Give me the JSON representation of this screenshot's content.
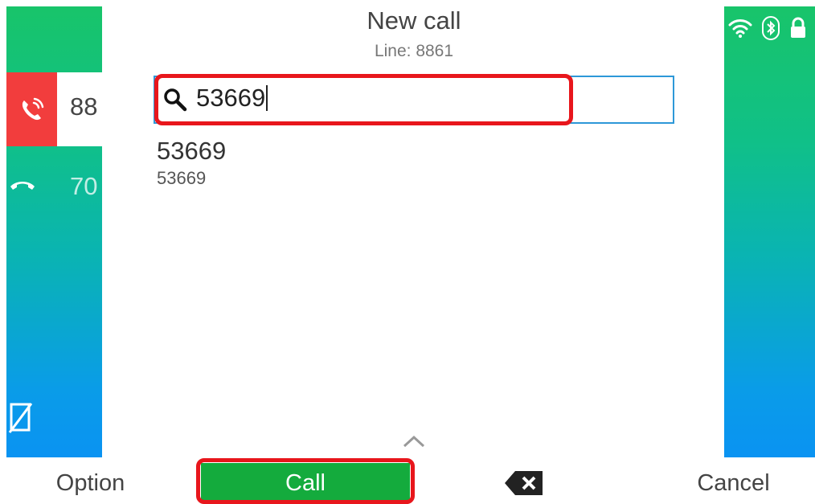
{
  "header": {
    "title": "New call",
    "subtitle": "Line: 8861"
  },
  "lines": [
    {
      "label": "88",
      "state": "active",
      "icon": "call-active-icon",
      "color": "#f23d3d"
    },
    {
      "label": "70",
      "state": "idle",
      "icon": "handset-icon"
    }
  ],
  "status_icons": [
    "wifi-icon",
    "bluetooth-icon",
    "lock-icon"
  ],
  "search": {
    "value": "53669"
  },
  "results": [
    {
      "name": "53669",
      "number": "53669"
    }
  ],
  "softkeys": {
    "option": "Option",
    "call": "Call",
    "backspace_icon": "backspace-icon",
    "cancel": "Cancel"
  },
  "colors": {
    "accent_blue": "#2d98d8",
    "call_green": "#14ab3d",
    "highlight_red": "#e8161c",
    "line_active_red": "#f23d3d"
  }
}
